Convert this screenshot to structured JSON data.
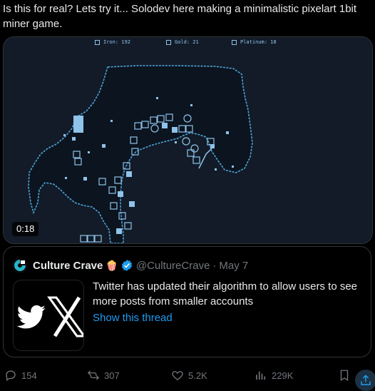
{
  "post": {
    "text": "Is this for real? Lets try it... Solodev here making a minimalistic pixelart 1bit miner game."
  },
  "video": {
    "duration": "0:18",
    "hud": {
      "iron_label": "Iron: 192",
      "gold_label": "Gold: 21",
      "platinum_label": "Platinum: 18"
    },
    "palette": {
      "background": "#121b27",
      "cave_floor": "#0b141f",
      "outline": "#4fa3d9",
      "ore": "#8fc3ea"
    }
  },
  "quote": {
    "author_name": "Culture Crave",
    "emoji": "🍿",
    "handle": "@CultureCrave",
    "date": "May 7",
    "text": "Twitter has updated their algorithm to allow users to see more posts from smaller accounts",
    "link_label": "Show this thread",
    "thumbnail_icons": [
      "twitter-bird-icon",
      "x-logo-icon"
    ]
  },
  "actions": {
    "replies": "154",
    "reposts": "307",
    "likes": "5.2K",
    "views": "229K"
  },
  "colors": {
    "background": "#000000",
    "text": "#e7e9ea",
    "muted": "#71767b",
    "link": "#1d9bf0",
    "border": "#2f3336"
  }
}
